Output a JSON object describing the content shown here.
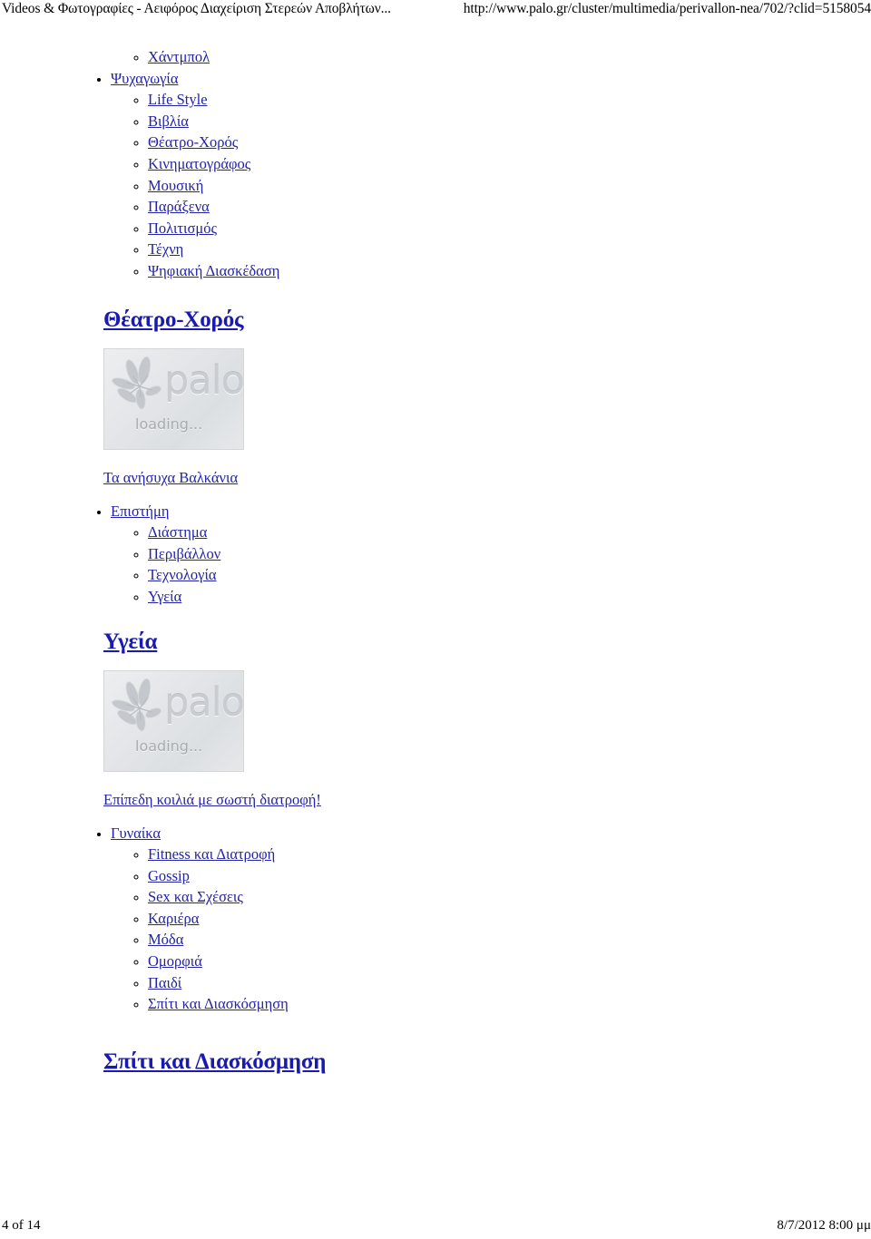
{
  "header": {
    "title": "Videos & Φωτογραφίες - Αειφόρος Διαχείριση Στερεών Αποβλήτων...",
    "url": "http://www.palo.gr/cluster/multimedia/perivallon-nea/702/?clid=5158054"
  },
  "orphan_list": {
    "items": [
      {
        "label": "Χάντμπολ"
      }
    ]
  },
  "groups": [
    {
      "label": "Ψυχαγωγία",
      "children": [
        {
          "label": "Life Style"
        },
        {
          "label": "Βιβλία"
        },
        {
          "label": "Θέατρο-Χορός"
        },
        {
          "label": "Κινηματογράφος"
        },
        {
          "label": "Μουσική"
        },
        {
          "label": "Παράξενα"
        },
        {
          "label": "Πολιτισμός"
        },
        {
          "label": "Τέχνη"
        },
        {
          "label": "Ψηφιακή Διασκέδαση"
        }
      ]
    },
    {
      "label": "Επιστήμη",
      "children": [
        {
          "label": "Διάστημα"
        },
        {
          "label": "Περιβάλλον"
        },
        {
          "label": "Τεχνολογία"
        },
        {
          "label": "Υγεία"
        }
      ]
    },
    {
      "label": "Γυναίκα",
      "children": [
        {
          "label": "Fitness και Διατροφή"
        },
        {
          "label": "Gossip"
        },
        {
          "label": "Sex και Σχέσεις"
        },
        {
          "label": "Καριέρα"
        },
        {
          "label": "Μόδα"
        },
        {
          "label": "Ομορφιά"
        },
        {
          "label": "Παιδί"
        },
        {
          "label": "Σπίτι και Διασκόσμηση"
        }
      ]
    }
  ],
  "sections": [
    {
      "title": "Θέατρο-Χορός",
      "image": {
        "brand": "palo",
        "status": "loading...",
        "alt": "palo-loading-placeholder"
      },
      "caption": "Τα ανήσυχα Βαλκάνια"
    },
    {
      "title": "Υγεία",
      "image": {
        "brand": "palo",
        "status": "loading...",
        "alt": "palo-loading-placeholder"
      },
      "caption": "Επίπεδη κοιλιά με σωστή διατροφή!"
    },
    {
      "title": "Σπίτι και Διασκόσμηση"
    }
  ],
  "footer": {
    "page": "4 of 14",
    "timestamp": "8/7/2012 8:00 μμ"
  },
  "colors": {
    "link": "#2323a8",
    "heading_link": "#1a1ab0",
    "text": "#000000",
    "background": "#ffffff",
    "image_placeholder_bg": "#e3e5e8"
  }
}
